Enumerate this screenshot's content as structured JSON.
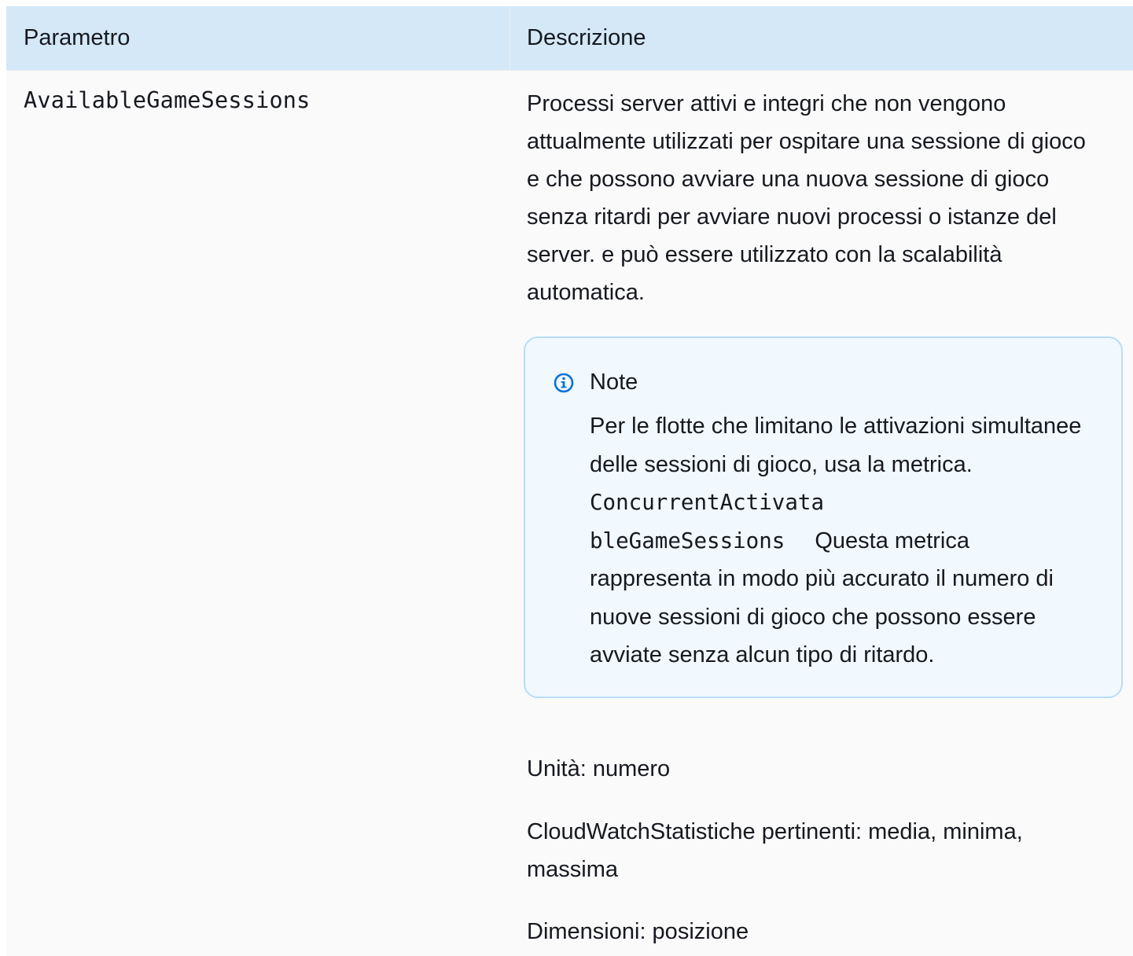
{
  "table": {
    "headers": {
      "parameter": "Parametro",
      "description": "Descrizione"
    },
    "rows": [
      {
        "parameter": "AvailableGameSessions",
        "description": "Processi server attivi e integri che non vengono attualmente utilizzati per ospitare una sessione di gioco e che possono avviare una nuova sessione di gioco senza ritardi per avviare nuovi processi o istanze del server. e può essere utilizzato con la scalabilità automatica.",
        "note": {
          "icon": "info-circle-icon",
          "title": "Note",
          "text_before": "Per le flotte che limitano le attivazioni simultanee delle sessioni di gioco, usa la metrica.",
          "code_part1": "ConcurrentActivata",
          "code_part2": "bleGameSessions",
          "text_after": "Questa metrica rappresenta in modo più accurato il numero di nuove sessioni di gioco che possono essere avviate senza alcun tipo di ritardo."
        },
        "unit": "Unità: numero",
        "statistics": "CloudWatchStatistiche pertinenti: media, minima, massima",
        "dimensions": "Dimensioni: posizione"
      }
    ]
  },
  "colors": {
    "header_bg": "#d5e8f8",
    "table_bg": "#fafafa",
    "note_bg": "#f1f8fe",
    "note_border": "#b9dcf7",
    "info_icon": "#0972d3",
    "text": "#16191f"
  }
}
